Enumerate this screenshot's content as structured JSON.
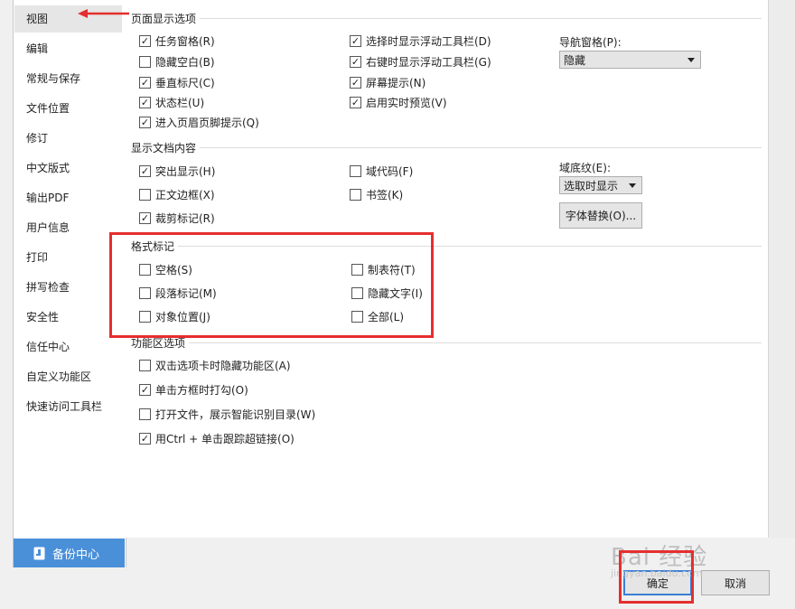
{
  "sidebar": {
    "items": [
      {
        "label": "视图",
        "active": true
      },
      {
        "label": "编辑"
      },
      {
        "label": "常规与保存"
      },
      {
        "label": "文件位置"
      },
      {
        "label": "修订"
      },
      {
        "label": "中文版式"
      },
      {
        "label": "输出PDF"
      },
      {
        "label": "用户信息"
      },
      {
        "label": "打印"
      },
      {
        "label": "拼写检查"
      },
      {
        "label": "安全性"
      },
      {
        "label": "信任中心"
      },
      {
        "label": "自定义功能区"
      },
      {
        "label": "快速访问工具栏"
      }
    ],
    "backup_label": "备份中心"
  },
  "page_display": {
    "title": "页面显示选项",
    "col1": [
      {
        "label": "任务窗格(R)",
        "checked": true
      },
      {
        "label": "隐藏空白(B)",
        "checked": false
      },
      {
        "label": "垂直标尺(C)",
        "checked": true
      },
      {
        "label": "状态栏(U)",
        "checked": true
      },
      {
        "label": "进入页眉页脚提示(Q)",
        "checked": true
      }
    ],
    "col2": [
      {
        "label": "选择时显示浮动工具栏(D)",
        "checked": true
      },
      {
        "label": "右键时显示浮动工具栏(G)",
        "checked": true
      },
      {
        "label": "屏幕提示(N)",
        "checked": true
      },
      {
        "label": "启用实时预览(V)",
        "checked": true
      }
    ],
    "nav_pane_label": "导航窗格(P):",
    "nav_pane_value": "隐藏"
  },
  "doc_content": {
    "title": "显示文档内容",
    "col1": [
      {
        "label": "突出显示(H)",
        "checked": true
      },
      {
        "label": "正文边框(X)",
        "checked": false
      },
      {
        "label": "裁剪标记(R)",
        "checked": true
      }
    ],
    "col2": [
      {
        "label": "域代码(F)",
        "checked": false
      },
      {
        "label": "书签(K)",
        "checked": false
      }
    ],
    "field_shading_label": "域底纹(E):",
    "field_shading_value": "选取时显示",
    "font_sub_button": "字体替换(O)..."
  },
  "format_marks": {
    "title": "格式标记",
    "col1": [
      {
        "label": "空格(S)",
        "checked": false
      },
      {
        "label": "段落标记(M)",
        "checked": false
      },
      {
        "label": "对象位置(J)",
        "checked": false
      }
    ],
    "col2": [
      {
        "label": "制表符(T)",
        "checked": false
      },
      {
        "label": "隐藏文字(I)",
        "checked": false
      },
      {
        "label": "全部(L)",
        "checked": false
      }
    ]
  },
  "ribbon": {
    "title": "功能区选项",
    "items": [
      {
        "label": "双击选项卡时隐藏功能区(A)",
        "checked": false
      },
      {
        "label": "单击方框时打勾(O)",
        "checked": true
      },
      {
        "label": "打开文件，展示智能识别目录(W)",
        "checked": false
      },
      {
        "label": "用Ctrl + 单击跟踪超链接(O)",
        "checked": true
      }
    ]
  },
  "footer": {
    "ok_label": "确定",
    "cancel_label": "取消"
  },
  "watermark": {
    "text": "Bai 经验",
    "sub": "jingyan.baidu.com"
  },
  "colors": {
    "annotation": "#e52e2e",
    "accent": "#4a90d9"
  },
  "check_glyph": "✓"
}
